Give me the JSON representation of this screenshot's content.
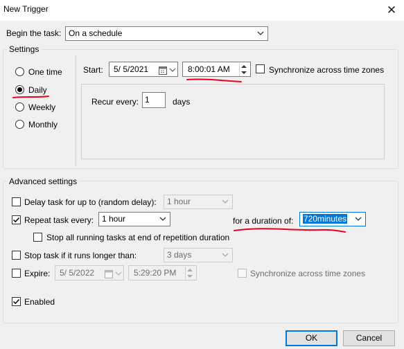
{
  "window": {
    "title": "New Trigger",
    "close_icon": "close-icon"
  },
  "begin": {
    "label": "Begin the task:",
    "value": "On a schedule"
  },
  "settings": {
    "group_label": "Settings",
    "frequency_options": [
      "One time",
      "Daily",
      "Weekly",
      "Monthly"
    ],
    "selected": "Daily",
    "start_label": "Start:",
    "start_date": "5/  5/2021",
    "start_time": "8:00:01 AM",
    "sync_label": "Synchronize across time zones",
    "sync_checked": false,
    "recur_label": "Recur every:",
    "recur_value": "1",
    "recur_unit": "days"
  },
  "advanced": {
    "group_label": "Advanced settings",
    "delay_label": "Delay task for up to (random delay):",
    "delay_checked": false,
    "delay_value": "1 hour",
    "repeat_label": "Repeat task every:",
    "repeat_checked": true,
    "repeat_value": "1 hour",
    "duration_label": "for a duration of:",
    "duration_value": "720minutes",
    "stop_all_label": "Stop all running tasks at end of repetition duration",
    "stop_all_checked": false,
    "stop_if_label": "Stop task if it runs longer than:",
    "stop_if_checked": false,
    "stop_if_value": "3 days",
    "expire_label": "Expire:",
    "expire_checked": false,
    "expire_date": "5/  5/2022",
    "expire_time": "5:29:20 PM",
    "expire_sync_label": "Synchronize across time zones",
    "enabled_label": "Enabled",
    "enabled_checked": true
  },
  "buttons": {
    "ok": "OK",
    "cancel": "Cancel"
  },
  "colors": {
    "accent": "#0078d7",
    "annotation": "#e8001c"
  }
}
